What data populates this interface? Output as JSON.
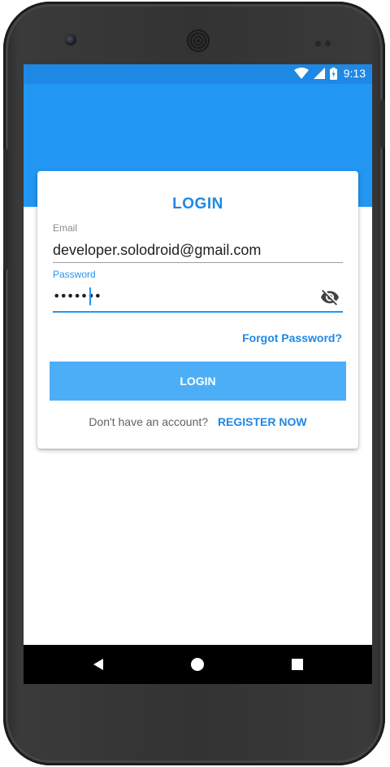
{
  "status_bar": {
    "time": "9:13",
    "icons": [
      "wifi-icon",
      "signal-icon",
      "battery-icon"
    ]
  },
  "login_card": {
    "title": "LOGIN",
    "email": {
      "label": "Email",
      "value": "developer.solodroid@gmail.com"
    },
    "password": {
      "label": "Password",
      "value": "•••••••",
      "toggle_icon": "eye-off-icon"
    },
    "forgot_password": "Forgot Password?",
    "login_button": "LOGIN",
    "register_prompt": "Don't have an account?",
    "register_link": "REGISTER NOW"
  },
  "nav_bar": {
    "buttons": [
      "back-icon",
      "home-icon",
      "recents-icon"
    ]
  },
  "colors": {
    "primary": "#2196f3",
    "primary_dark": "#1e88e5",
    "button": "#4caef7",
    "text": "#212121",
    "hint": "#8a8a8a"
  }
}
